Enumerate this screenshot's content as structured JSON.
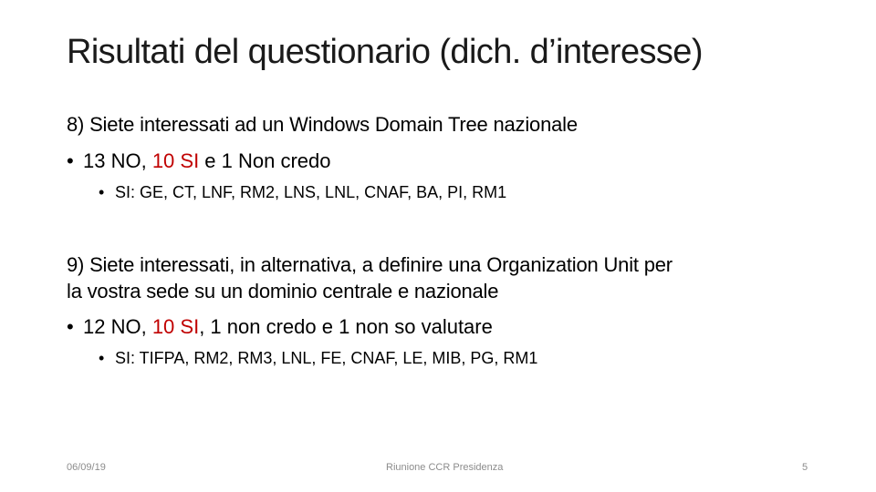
{
  "slide": {
    "title": "Risultati del questionario (dich. d’interesse)",
    "q8": {
      "question": "8) Siete interessati ad un Windows Domain Tree nazionale",
      "answer_pre": "13 NO, ",
      "answer_highlight": "10 SI",
      "answer_post": " e 1 Non credo",
      "sub": "SI: GE, CT, LNF, RM2, LNS, LNL, CNAF, BA, PI, RM1"
    },
    "q9": {
      "question_line1": "9) Siete interessati, in alternativa, a definire una Organization Unit per",
      "question_line2": "la vostra sede su un dominio centrale e nazionale",
      "answer_pre": "12 NO, ",
      "answer_highlight": "10 SI",
      "answer_post": ", 1 non credo e 1 non so valutare",
      "sub": "SI: TIFPA, RM2, RM3, LNL, FE, CNAF, LE, MIB, PG, RM1"
    },
    "bullet": "•",
    "highlight_color": "#c00000"
  },
  "footer": {
    "date": "06/09/19",
    "center": "Riunione CCR Presidenza",
    "page": "5"
  }
}
